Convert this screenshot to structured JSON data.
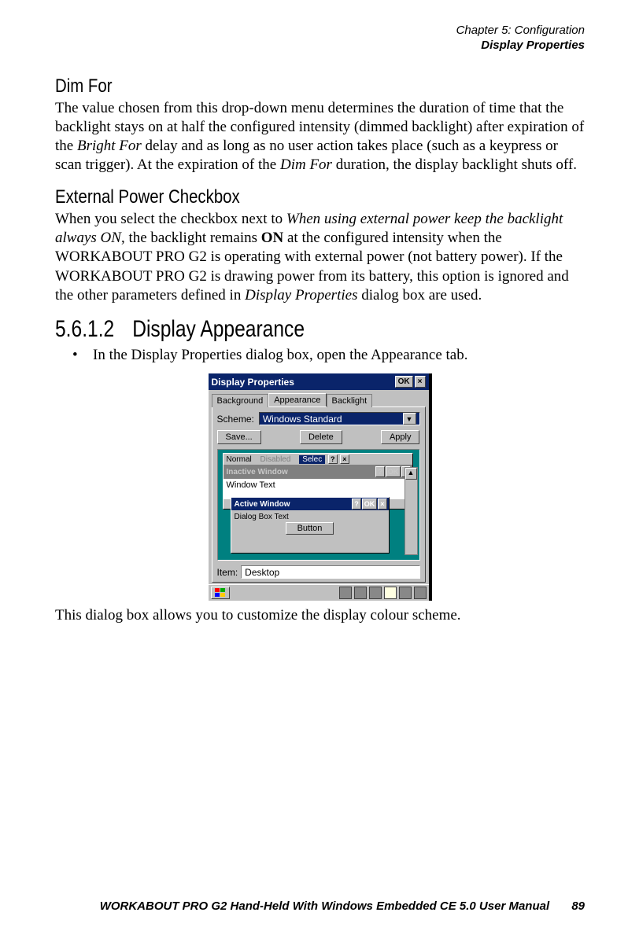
{
  "header": {
    "chapter": "Chapter 5: Configuration",
    "section": "Display Properties"
  },
  "s1": {
    "title": "Dim For",
    "p1a": "The value chosen from this drop-down menu determines the duration of time that the backlight stays on at half the configured intensity (dimmed backlight) after expiration of the ",
    "p1b": "Bright For",
    "p1c": " delay and as long as no user action takes place (such as a keypress or scan trigger). At the expiration of the ",
    "p1d": "Dim For",
    "p1e": " duration, the display backlight shuts off."
  },
  "s2": {
    "title": "External Power Checkbox",
    "p1a": "When you select the checkbox next to ",
    "p1b": "When using external power keep the backlight always ON",
    "p1c": ", the backlight remains ",
    "p1d": "ON",
    "p1e": " at the configured intensity when the WORKABOUT PRO G2 is operating with external power (not battery power). If the WORKABOUT PRO G2 is drawing power from its battery, this option is ignored and the other parameters defined in ",
    "p1f": "Display Properties",
    "p1g": " dialog box are used."
  },
  "s3": {
    "num": "5.6.1.2",
    "title": "Display Appearance",
    "bullet_a": "In the ",
    "bullet_b": "Display Properties",
    "bullet_c": " dialog box, open the ",
    "bullet_d": "Appearance",
    "bullet_e": " tab.",
    "after": "This dialog box allows you to customize the display colour scheme."
  },
  "dlg": {
    "title": "Display Properties",
    "ok": "OK",
    "x": "×",
    "tabs": {
      "background": "Background",
      "appearance": "Appearance",
      "backlight": "Backlight"
    },
    "scheme_label": "Scheme:",
    "scheme_value": "Windows Standard",
    "save": "Save...",
    "delete": "Delete",
    "apply": "Apply",
    "menu_normal": "Normal",
    "menu_disabled": "Disabled",
    "menu_selected": "Selec",
    "q": "?",
    "inactive_title": "Inactive Window",
    "window_text": "Window Text",
    "active_title": "Active Window",
    "dialog_text": "Dialog Box Text",
    "button": "Button",
    "item_label": "Item:",
    "item_value": "Desktop"
  },
  "footer": {
    "text": "WORKABOUT PRO G2 Hand-Held With Windows Embedded CE 5.0 User Manual",
    "page": "89"
  }
}
